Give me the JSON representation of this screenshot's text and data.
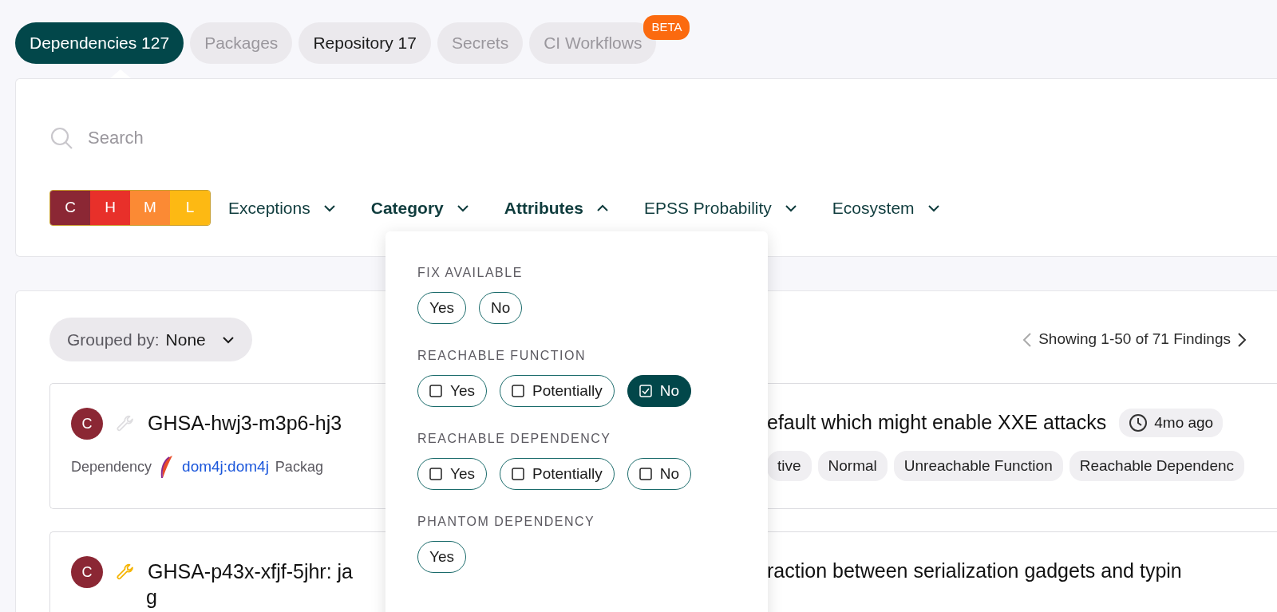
{
  "tabs": [
    {
      "label": "Dependencies",
      "count": "127",
      "selected": true,
      "disabled": false
    },
    {
      "label": "Packages",
      "selected": false,
      "disabled": true
    },
    {
      "label": "Repository",
      "count": "17",
      "selected": false,
      "disabled": false
    },
    {
      "label": "Secrets",
      "selected": false,
      "disabled": true
    },
    {
      "label": "CI Workflows",
      "selected": false,
      "disabled": true,
      "badge": "BETA"
    }
  ],
  "search": {
    "placeholder": "Search"
  },
  "severity": [
    {
      "label": "C",
      "color": "#8b2734"
    },
    {
      "label": "H",
      "color": "#e8302a"
    },
    {
      "label": "M",
      "color": "#fb8a34"
    },
    {
      "label": "L",
      "color": "#fdb913"
    }
  ],
  "filters": [
    {
      "label": "Exceptions",
      "active": false,
      "expanded": false
    },
    {
      "label": "Category",
      "active": true,
      "expanded": false
    },
    {
      "label": "Attributes",
      "active": true,
      "expanded": true
    },
    {
      "label": "EPSS Probability",
      "active": false,
      "expanded": false
    },
    {
      "label": "Ecosystem",
      "active": false,
      "expanded": false
    }
  ],
  "attributes_menu": [
    {
      "heading": "FIX AVAILABLE",
      "kind": "plain",
      "options": [
        {
          "label": "Yes",
          "selected": false
        },
        {
          "label": "No",
          "selected": false
        }
      ]
    },
    {
      "heading": "REACHABLE FUNCTION",
      "kind": "checkbox",
      "options": [
        {
          "label": "Yes",
          "selected": false
        },
        {
          "label": "Potentially",
          "selected": false
        },
        {
          "label": "No",
          "selected": true
        }
      ]
    },
    {
      "heading": "REACHABLE DEPENDENCY",
      "kind": "checkbox",
      "options": [
        {
          "label": "Yes",
          "selected": false
        },
        {
          "label": "Potentially",
          "selected": false
        },
        {
          "label": "No",
          "selected": false
        }
      ]
    },
    {
      "heading": "PHANTOM DEPENDENCY",
      "kind": "plain",
      "options": [
        {
          "label": "Yes",
          "selected": false
        }
      ]
    }
  ],
  "grouping": {
    "label": "Grouped by:",
    "value": "None"
  },
  "pagination": {
    "text": "Showing 1-50 of 71 Findings"
  },
  "findings": [
    {
      "severity": "C",
      "fix_available": false,
      "title_left": "GHSA-hwj3-m3p6-hj3",
      "title_right": "efault which might enable XXE attacks",
      "time": "4mo ago",
      "meta_label": "Dependency",
      "package": "dom4j:dom4j",
      "meta_cut": "Packag",
      "tags": [
        "tive",
        "Normal",
        "Unreachable Function",
        "Reachable Dependenc"
      ]
    },
    {
      "severity": "C",
      "fix_available": true,
      "title_left": "GHSA-p43x-xfjf-5jhr: ja",
      "title_right": "raction between serialization gadgets and typin",
      "title_wrap": "g"
    }
  ]
}
